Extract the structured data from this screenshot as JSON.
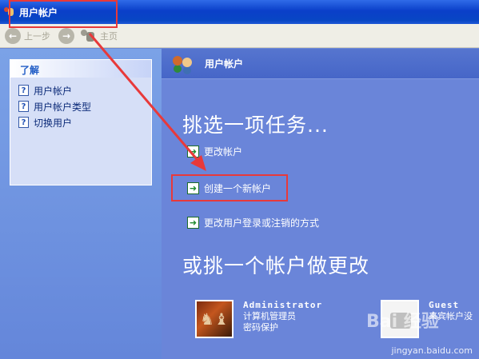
{
  "window": {
    "title": "用户帐户"
  },
  "toolbar": {
    "back_label": "上一步",
    "home_label": "主页"
  },
  "sidebar": {
    "heading": "了解",
    "items": [
      {
        "label": "用户帐户"
      },
      {
        "label": "用户帐户类型"
      },
      {
        "label": "切换用户"
      }
    ]
  },
  "main": {
    "header_title": "用户帐户",
    "pick_task": "挑选一项任务...",
    "tasks": [
      {
        "label": "更改帐户"
      },
      {
        "label": "创建一个新帐户"
      },
      {
        "label": "更改用户登录或注销的方式"
      }
    ],
    "pick_account": "或挑一个帐户做更改",
    "accounts": [
      {
        "name": "Administrator",
        "line1": "计算机管理员",
        "line2": "密码保护"
      },
      {
        "name": "Guest",
        "line1": "来宾帐户没"
      }
    ]
  },
  "watermark": {
    "brand": "Bai 经验",
    "url": "jingyan.baidu.com"
  },
  "colors": {
    "annotation": "#e8393a",
    "titlebar": "#0a3fc9",
    "task_pane": "#6a85d9"
  }
}
